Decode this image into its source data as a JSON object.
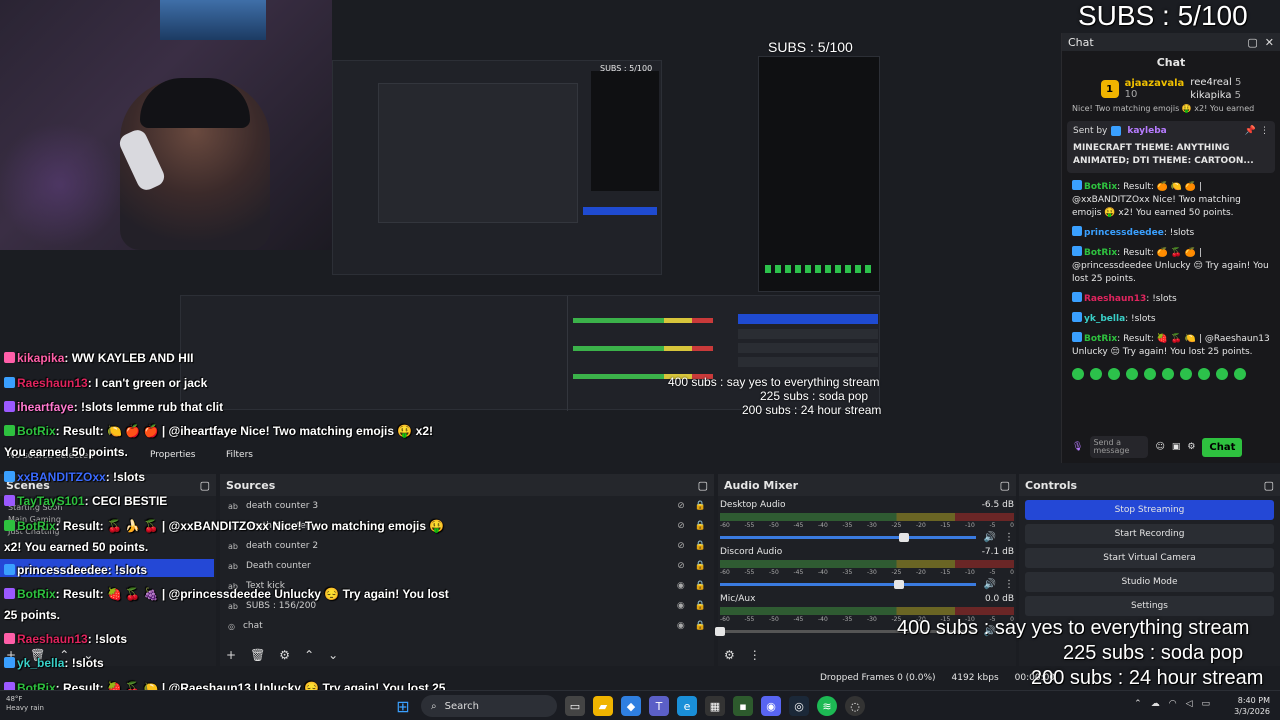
{
  "overlay": {
    "subs_goal_main": "SUBS : 5/100",
    "subs_goal_mid": "SUBS : 5/100",
    "subs_goal_small": "SUBS : 5/100",
    "goals": [
      "400 subs : say yes to everything stream",
      "225 subs : soda pop",
      "200 subs : 24 hour stream"
    ],
    "nested_goals": [
      "400 subs : say yes to everything stream",
      "225 subs : soda pop",
      "200 subs : 24 hour stream"
    ]
  },
  "chat_panel": {
    "dock_title": "Chat",
    "title": "Chat",
    "leaderboard": [
      {
        "rank": "1",
        "name": "ajaazavala",
        "score": "10"
      },
      {
        "name": "ree4real",
        "score": "5"
      },
      {
        "name": "kikapika",
        "score": "5"
      }
    ],
    "truncated_line": "Nice! Two matching emojis 🤑 x2! You earned",
    "pinned": {
      "label": "Sent by",
      "author": "kayleba",
      "message": "MINECRAFT THEME: ANYTHING ANIMATED; DTI THEME: CARTOON..."
    },
    "messages": [
      {
        "user": "BotRix",
        "color": "#2ec13f",
        "text": ": Result: 🍊 🍋 🍊 | @xxBANDITZOxx Nice! Two matching emojis 🤑 x2! You earned 50 points."
      },
      {
        "user": "princessdeedee",
        "color": "#3aa0ff",
        "text": ": !slots"
      },
      {
        "user": "BotRix",
        "color": "#2ec13f",
        "text": ": Result: 🍊 🍒 🍊 | @princessdeedee Unlucky 😔 Try again! You lost 25 points."
      },
      {
        "user": "Raeshaun13",
        "color": "#e0245e",
        "text": ": !slots"
      },
      {
        "user": "yk_bella",
        "color": "#39d0c8",
        "text": ": !slots"
      },
      {
        "user": "BotRix",
        "color": "#2ec13f",
        "text": ": Result: 🍓 🍒 🍋 | @Raeshaun13 Unlucky 😔 Try again! You lost 25 points."
      }
    ],
    "input_placeholder": "Send a message",
    "chat_button": "Chat"
  },
  "overlay_chat": [
    {
      "user": "kikapika",
      "color": "#ff5fa8",
      "text": ": WW KAYLEB AND HII"
    },
    {
      "user": "Raeshaun13",
      "color": "#e0245e",
      "text": ": I can't green or jack"
    },
    {
      "user": "iheartfaye",
      "color": "#ff7ad0",
      "text": ": !slots lemme rub that clit"
    },
    {
      "user": "BotRix",
      "color": "#2ec13f",
      "text": ": Result: 🍋 🍎 🍎 | @iheartfaye Nice! Two matching emojis 🤑 x2!"
    },
    {
      "user": "",
      "color": "#fff",
      "text": "You earned 50 points."
    },
    {
      "user": "xxBANDITZOxx",
      "color": "#3b6bff",
      "text": ": !slots"
    },
    {
      "user": "TayTayS101",
      "color": "#2ec13f",
      "text": ": CECI BESTIE"
    },
    {
      "user": "BotRix",
      "color": "#2ec13f",
      "text": ": Result: 🍒 🍌 🍒 | @xxBANDITZOxx Nice! Two matching emojis 🤑"
    },
    {
      "user": "",
      "color": "#fff",
      "text": "x2! You earned 50 points."
    },
    {
      "user": "princessdeedee",
      "color": "#ffffff",
      "text": ": !slots"
    },
    {
      "user": "BotRix",
      "color": "#2ec13f",
      "text": ": Result: 🍓 🍒 🍇 | @princessdeedee Unlucky 😔 Try again! You lost"
    },
    {
      "user": "",
      "color": "#fff",
      "text": "25 points."
    },
    {
      "user": "Raeshaun13",
      "color": "#e0245e",
      "text": ": !slots"
    },
    {
      "user": "yk_bella",
      "color": "#39d0c8",
      "text": ": !slots"
    },
    {
      "user": "BotRix",
      "color": "#2ec13f",
      "text": ": Result: 🍓 🍒 🍋 | @Raeshaun13 Unlucky 😔 Try again! You lost 25"
    },
    {
      "user": "",
      "color": "#fff",
      "text": "points."
    }
  ],
  "obs": {
    "no_source": "No source selected",
    "properties": "Properties",
    "filters": "Filters",
    "scenes_title": "Scenes",
    "scenes": [
      "Starting Soon",
      "Main Gaming",
      "Just Chatting"
    ],
    "sources_title": "Sources",
    "sources": [
      "death counter 3",
      "death counter",
      "death counter 2",
      "Death counter",
      "Text kick",
      "SUBS : 156/200",
      "chat"
    ],
    "mixer_title": "Audio Mixer",
    "channels": [
      {
        "name": "Desktop Audio",
        "db": "-6.5 dB",
        "level": 0.72
      },
      {
        "name": "Discord Audio",
        "db": "-7.1 dB",
        "level": 0.7
      },
      {
        "name": "Mic/Aux",
        "db": "0.0 dB",
        "level": 0.0
      }
    ],
    "meter_ticks": [
      "-60",
      "-55",
      "-50",
      "-45",
      "-40",
      "-35",
      "-30",
      "-25",
      "-20",
      "-15",
      "-10",
      "-5",
      "0"
    ],
    "controls_title": "Controls",
    "controls": [
      "Stop Streaming",
      "Start Recording",
      "Start Virtual Camera",
      "Studio Mode",
      "Settings"
    ],
    "status": {
      "dropped": "Dropped Frames 0 (0.0%)",
      "kbps": "4192 kbps",
      "time": "00:00:00"
    }
  },
  "taskbar": {
    "weather_temp": "48°F",
    "weather_desc": "Heavy rain",
    "search": "Search",
    "time": "8:40 PM",
    "date": "3/3/2026"
  },
  "colors": {
    "accent_blue": "#2448d6",
    "twitch_green": "#2ec13f",
    "gold": "#f0b400"
  }
}
